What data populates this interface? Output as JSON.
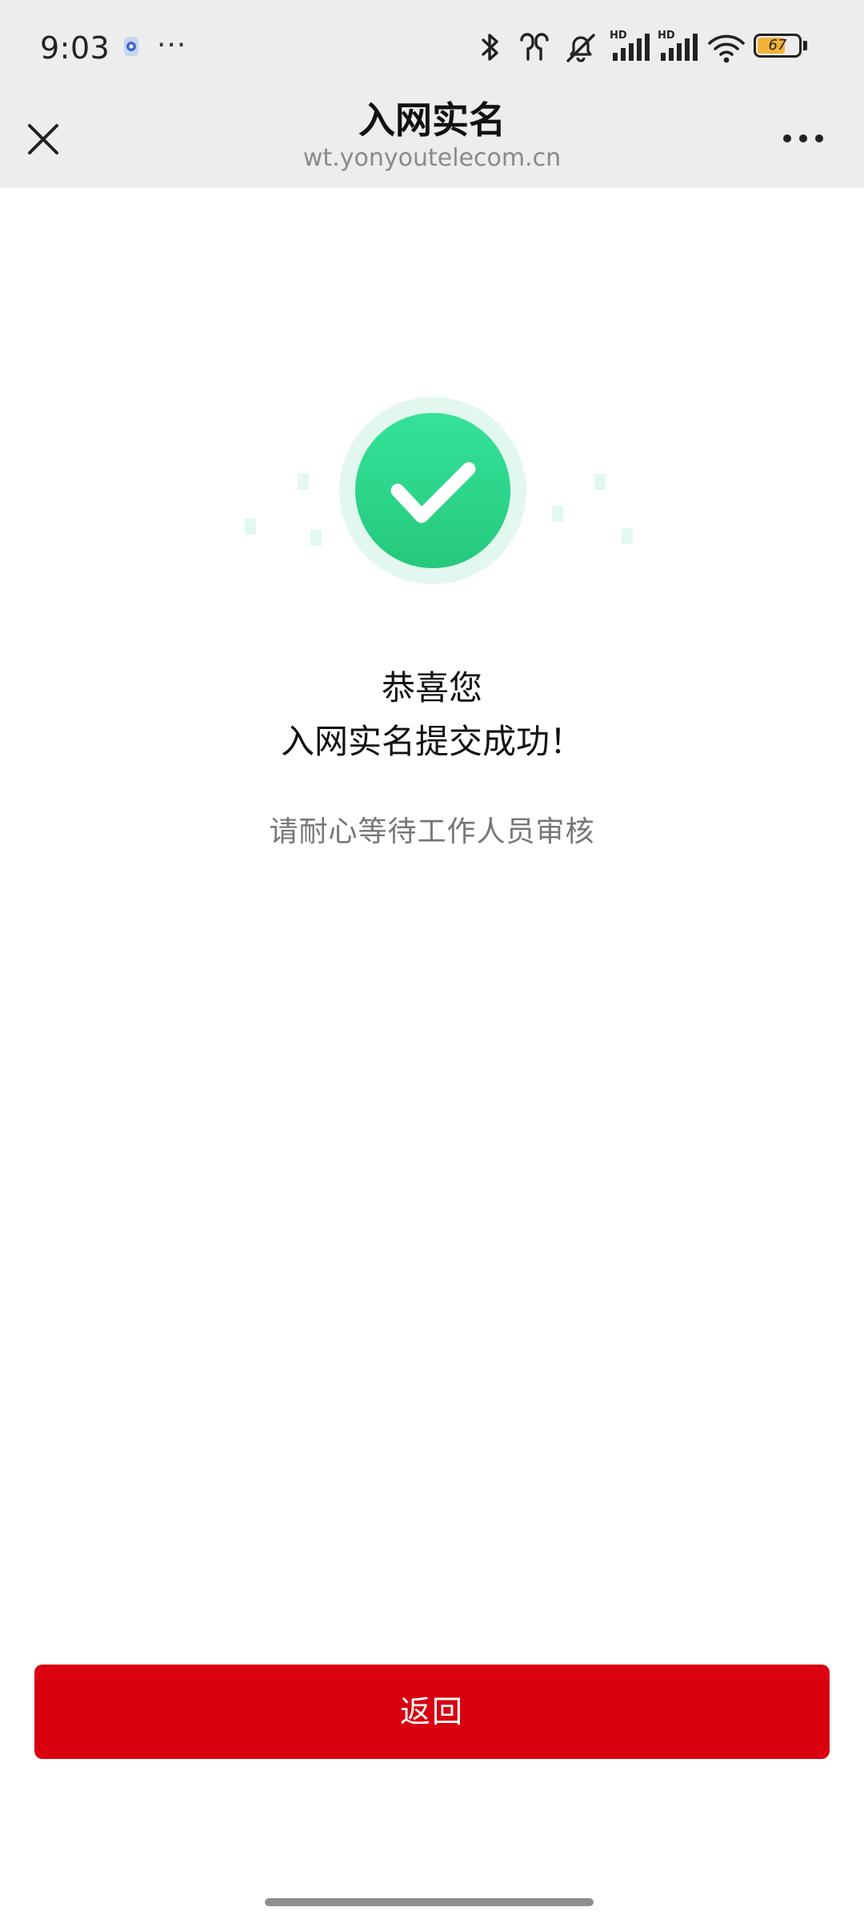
{
  "status_bar": {
    "time": "9:03",
    "more_dots": "···",
    "battery_level": "67",
    "network_badge": "HD",
    "icons": [
      "app-notification-icon",
      "bluetooth-icon",
      "earbuds-icon",
      "mute-icon",
      "signal-hd-icon",
      "signal-hd-icon",
      "wifi-icon",
      "battery-icon"
    ]
  },
  "title_bar": {
    "title": "入网实名",
    "url": "wt.yonyoutelecom.cn",
    "icons": [
      "close-icon",
      "more-icon"
    ]
  },
  "result": {
    "icon": "success-check-icon",
    "line1": "恭喜您",
    "line2": "入网实名提交成功！",
    "subtitle": "请耐心等待工作人员审核"
  },
  "actions": {
    "back_label": "返回"
  },
  "colors": {
    "accent_red": "#d9000f",
    "success_green": "#2fd98a",
    "chrome_gray": "#ededed"
  }
}
